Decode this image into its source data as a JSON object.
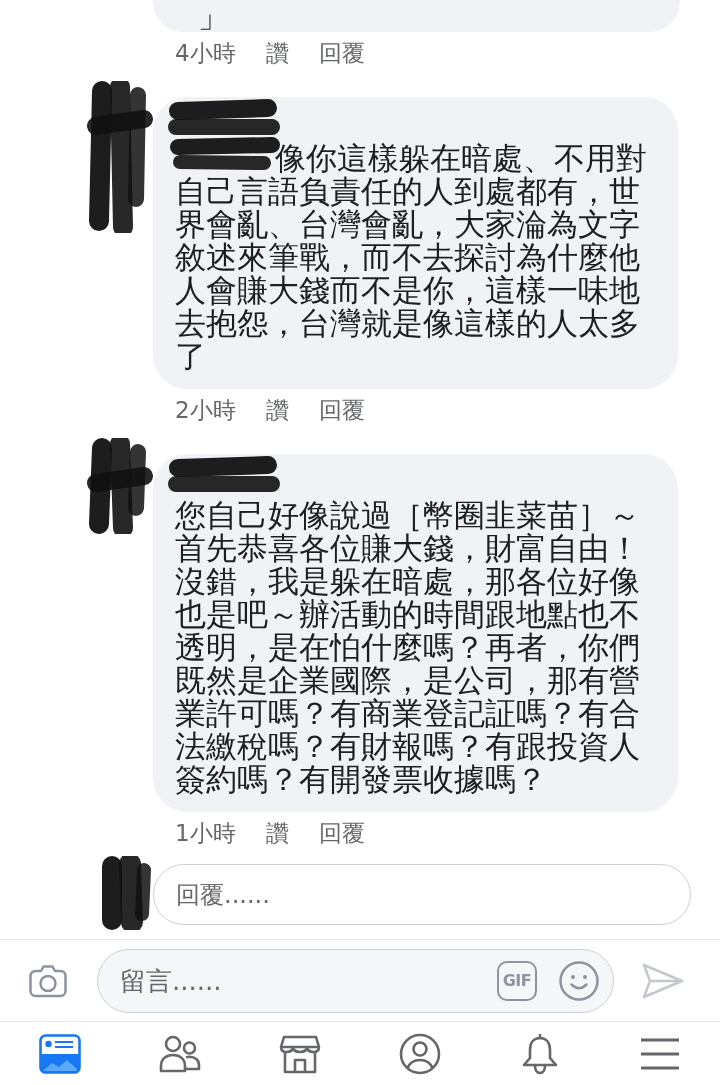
{
  "comments": [
    {
      "kind": "cut_off",
      "mention": false,
      "text": "」",
      "time": "4小時",
      "like": "讚",
      "reply": "回覆"
    },
    {
      "kind": "comment",
      "mention": true,
      "text": "像你這樣躲在暗處、不用對自己言語負責任的人到處都有，世界會亂、台灣會亂，大家淪為文字敘述來筆戰，而不去探討為什麼他人會賺大錢而不是你，這樣一味地去抱怨，台灣就是像這樣的人太多了",
      "time": "2小時",
      "like": "讚",
      "reply": "回覆"
    },
    {
      "kind": "comment",
      "mention": false,
      "text": "您自己好像說過［幣圈韭菜苗］～首先恭喜各位賺大錢，財富自由！沒錯，我是躲在暗處，那各位好像也是吧～辦活動的時間跟地點也不透明，是在怕什麼嗎？再者，你們既然是企業國際，是公司，那有營業許可嗎？有商業登記証嗎？有合法繳稅嗎？有財報嗎？有跟投資人簽約嗎？有開發票收據嗎？",
      "time": "1小時",
      "like": "讚",
      "reply": "回覆"
    }
  ],
  "reply_field": {
    "placeholder": "回覆......"
  },
  "composer": {
    "placeholder": "留言......",
    "gif": "GIF",
    "send": {
      "disabled": true
    }
  },
  "nav": [
    {
      "kind": "news_feed",
      "selected": true
    },
    {
      "kind": "friends",
      "selected": false
    },
    {
      "kind": "marketplace",
      "selected": false
    },
    {
      "kind": "profile",
      "selected": false
    },
    {
      "kind": "notifications",
      "selected": false
    },
    {
      "kind": "menu",
      "selected": false
    }
  ]
}
